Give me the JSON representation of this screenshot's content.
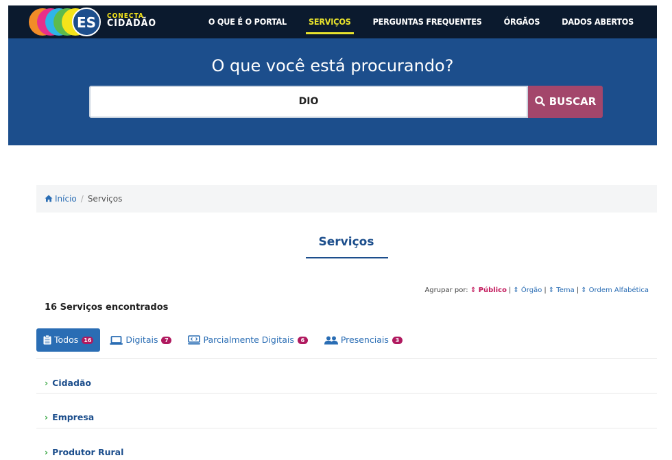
{
  "header": {
    "logo": {
      "line1": "CONECTA",
      "line2": "CIDADÃO",
      "badge": "ES"
    },
    "nav": [
      {
        "label": "O QUE É O PORTAL",
        "active": false
      },
      {
        "label": "SERVIÇOS",
        "active": true
      },
      {
        "label": "PERGUNTAS FREQUENTES",
        "active": false
      },
      {
        "label": "ÓRGÃOS",
        "active": false
      },
      {
        "label": "DADOS ABERTOS",
        "active": false
      }
    ]
  },
  "hero": {
    "title": "O que você está procurando?",
    "search_value": "DIO",
    "search_button": "BUSCAR"
  },
  "breadcrumb": {
    "home": "Início",
    "sep": "/",
    "current": "Serviços"
  },
  "page_title": "Serviços",
  "group_by": {
    "label": "Agrupar por:",
    "options": [
      {
        "label": "Público",
        "active": true
      },
      {
        "label": "Órgão",
        "active": false
      },
      {
        "label": "Tema",
        "active": false
      },
      {
        "label": "Ordem Alfabética",
        "active": false
      }
    ]
  },
  "results_count": "16 Serviços encontrados",
  "tabs": [
    {
      "label": "Todos",
      "count": "16",
      "icon": "clipboard-icon",
      "active": true
    },
    {
      "label": "Digitais",
      "count": "7",
      "icon": "laptop-icon",
      "active": false
    },
    {
      "label": "Parcialmente Digitais",
      "count": "6",
      "icon": "monitor-code-icon",
      "active": false
    },
    {
      "label": "Presenciais",
      "count": "3",
      "icon": "users-icon",
      "active": false
    }
  ],
  "categories": [
    {
      "label": "Cidadão"
    },
    {
      "label": "Empresa"
    },
    {
      "label": "Produtor Rural"
    }
  ],
  "colors": {
    "nav_bg": "#0b1a2e",
    "hero_bg": "#1c4e8c",
    "accent_yellow": "#e8e22c",
    "button_magenta": "#a3466b",
    "link_blue": "#2a6db4",
    "badge_magenta": "#b0195f",
    "chevron_green": "#3aa845"
  }
}
